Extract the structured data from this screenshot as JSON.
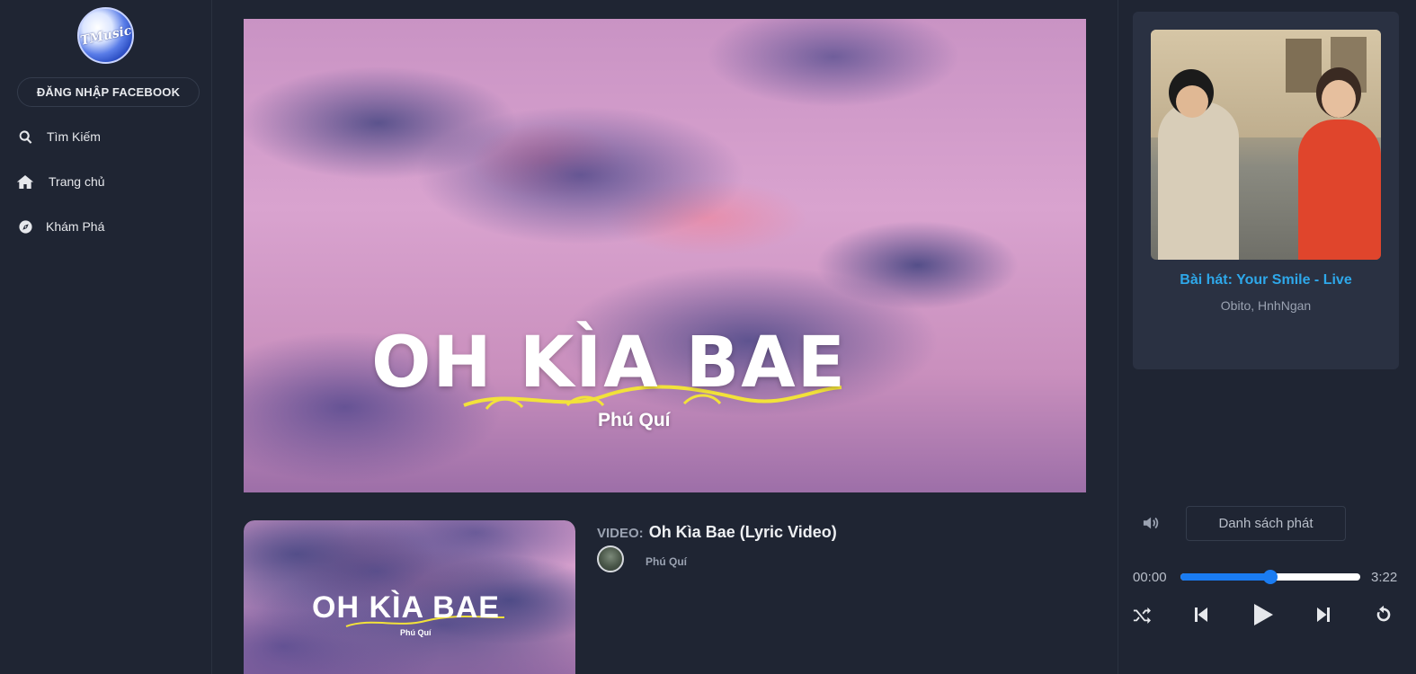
{
  "sidebar": {
    "logo_text": "TMusic",
    "facebook_login_label": "ĐĂNG NHẬP FACEBOOK",
    "nav": [
      {
        "label": "Tìm Kiếm",
        "icon": "search-icon"
      },
      {
        "label": "Trang chủ",
        "icon": "home-icon"
      },
      {
        "label": "Khám Phá",
        "icon": "compass-icon"
      }
    ]
  },
  "hero": {
    "title": "OH KÌA BAE",
    "subtitle": "Phú Quí"
  },
  "video": {
    "prefix": "VIDEO:",
    "title": "Oh Kìa Bae (Lyric Video)",
    "channel": "Phú Quí",
    "thumb_title": "OH KÌA BAE",
    "thumb_subtitle": "Phú Quí"
  },
  "player": {
    "song_title": "Bài hát: Your Smile - Live",
    "artist": "Obito, HnhNgan",
    "playlist_label": "Danh sách phát",
    "current_time": "00:00",
    "total_time": "3:22",
    "progress": 0.5,
    "accent_color": "#1a7cf2",
    "title_color": "#2ea8ea",
    "controls": [
      "shuffle-icon",
      "previous-icon",
      "play-icon",
      "next-icon",
      "repeat-icon"
    ]
  }
}
